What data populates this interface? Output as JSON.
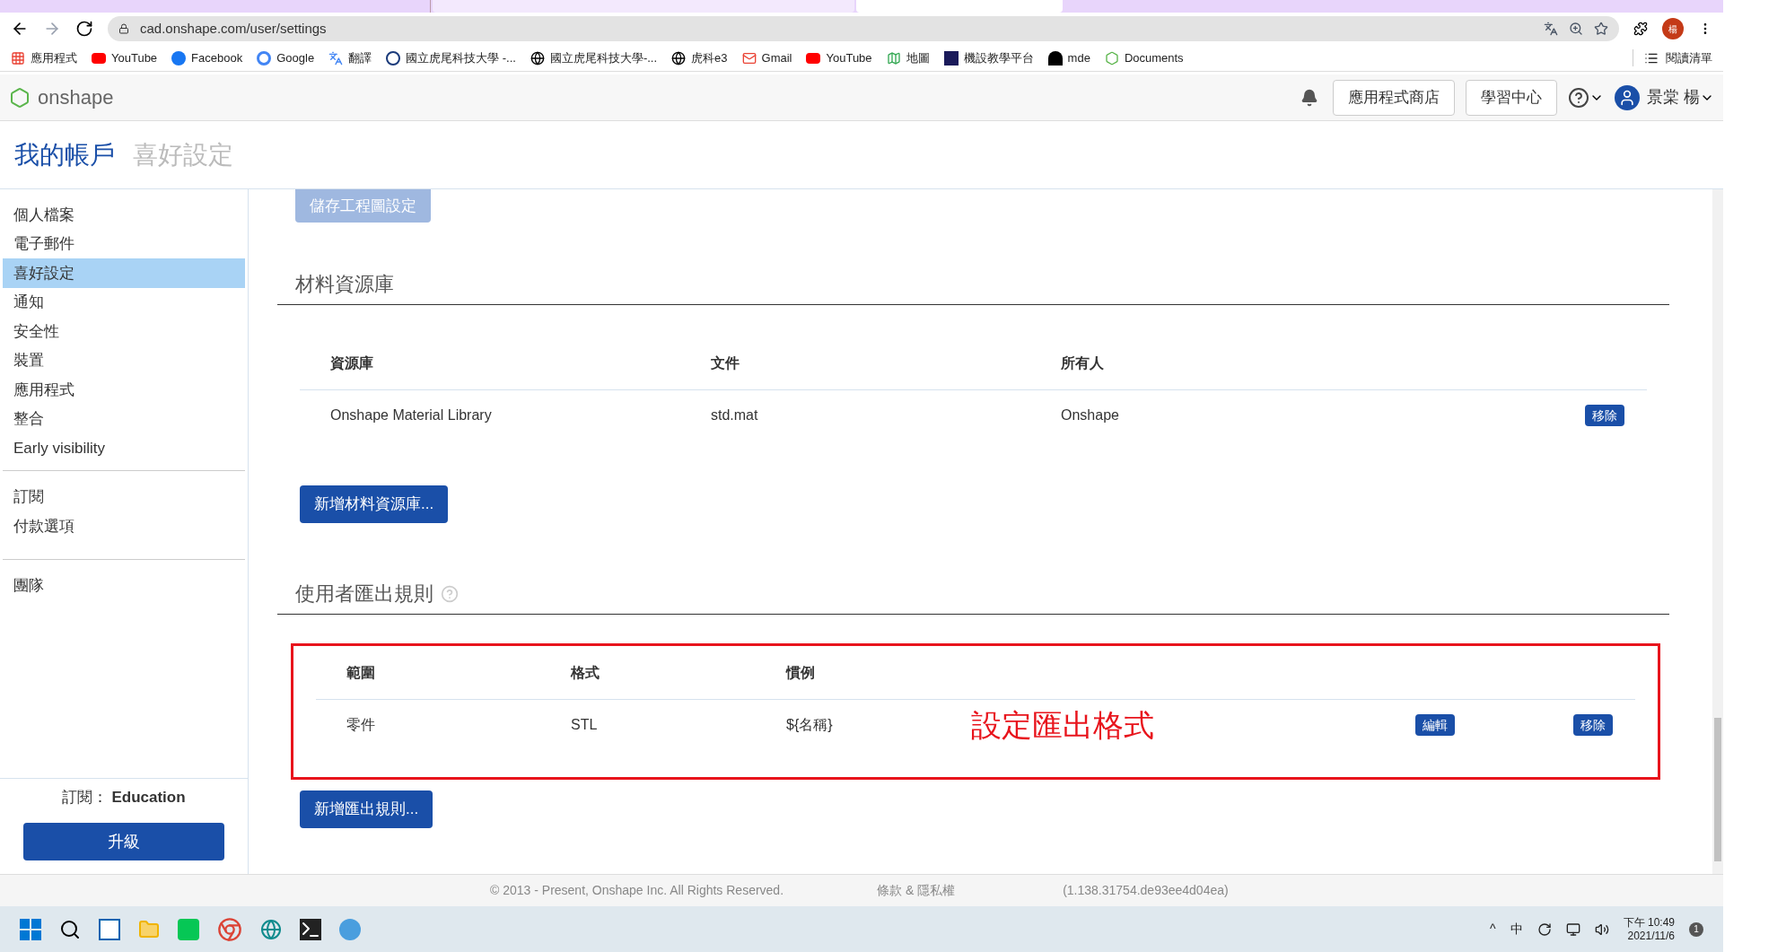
{
  "browser": {
    "address": "cad.onshape.com/user/settings",
    "bookmarks": [
      "應用程式",
      "YouTube",
      "Facebook",
      "Google",
      "翻譯",
      "國立虎尾科技大學 -...",
      "國立虎尾科技大學-...",
      "虎科e3",
      "Gmail",
      "YouTube",
      "地圖",
      "機設教學平台",
      "mde",
      "Documents"
    ],
    "reading_list": "閱讀清單",
    "profile": "楊"
  },
  "header": {
    "logo": "onshape",
    "app_store": "應用程式商店",
    "learning_center": "學習中心",
    "user": "景棠 楊"
  },
  "breadcrumb": {
    "account": "我的帳戶",
    "current": "喜好設定"
  },
  "sidebar": {
    "groups": [
      {
        "items": [
          {
            "label": "個人檔案",
            "selected": false
          },
          {
            "label": "電子郵件",
            "selected": false
          },
          {
            "label": "喜好設定",
            "selected": true
          },
          {
            "label": "通知",
            "selected": false
          },
          {
            "label": "安全性",
            "selected": false
          },
          {
            "label": "裝置",
            "selected": false
          },
          {
            "label": "應用程式",
            "selected": false
          },
          {
            "label": "整合",
            "selected": false
          },
          {
            "label": "Early visibility",
            "selected": false
          }
        ]
      },
      {
        "items": [
          {
            "label": "訂閱",
            "selected": false
          },
          {
            "label": "付款選項",
            "selected": false
          }
        ]
      },
      {
        "items": [
          {
            "label": "團隊",
            "selected": false
          }
        ]
      }
    ],
    "subscription_label": "訂閱：",
    "subscription": "Education",
    "upgrade": "升級"
  },
  "content": {
    "save_button": "儲存工程圖設定",
    "material_section": {
      "title": "材料資源庫",
      "columns": [
        "資源庫",
        "文件",
        "所有人"
      ],
      "rows": [
        {
          "cells": [
            "Onshape Material Library",
            "std.mat",
            "Onshape"
          ],
          "remove": "移除"
        }
      ],
      "add_button": "新增材料資源庫..."
    },
    "export_section": {
      "title": "使用者匯出規則",
      "columns": [
        "範圍",
        "格式",
        "慣例"
      ],
      "rows": [
        {
          "cells": [
            "零件",
            "STL",
            "${名稱}"
          ],
          "edit": "編輯",
          "remove": "移除"
        }
      ],
      "annotation": "設定匯出格式",
      "add_button": "新增匯出規則..."
    }
  },
  "footer": {
    "copyright": "© 2013 - Present, Onshape Inc. All Rights Reserved.",
    "terms": "條款 & 隱私權",
    "version": "(1.138.31754.de93ee4d04ea)"
  },
  "taskbar": {
    "tray_arrow": "^",
    "ime": "中",
    "time": "下午 10:49",
    "date": "2021/11/6",
    "notifications": "1"
  }
}
